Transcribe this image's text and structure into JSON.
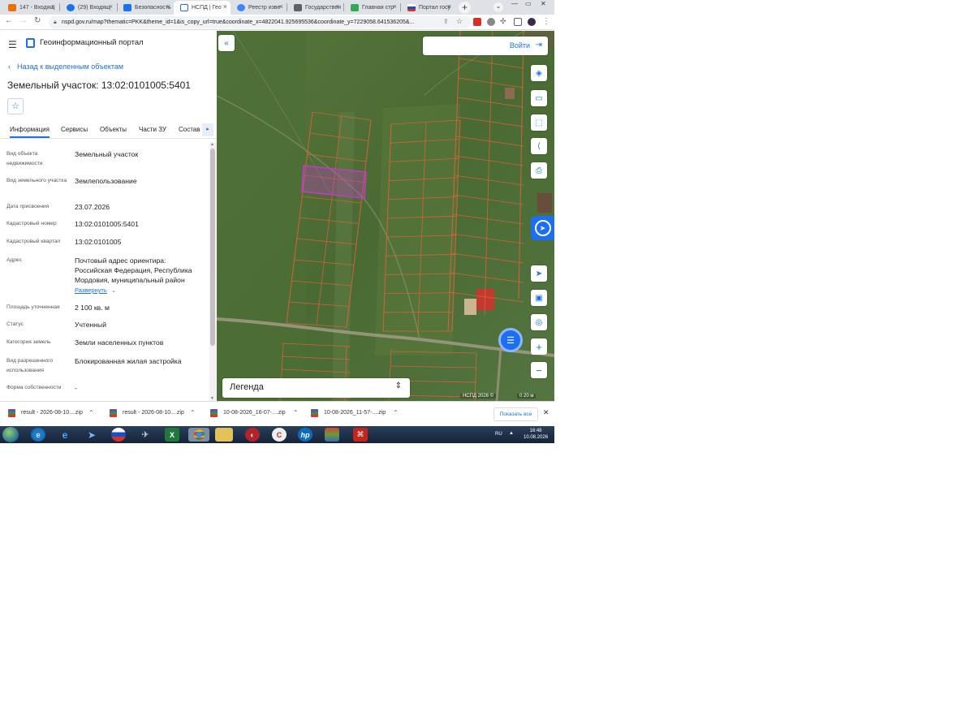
{
  "browser": {
    "tabs": [
      {
        "title": "147 - Входящ",
        "favicon_color": "#e8710a"
      },
      {
        "title": "(29) Входящ",
        "favicon_color": "#1a73e8"
      },
      {
        "title": "Безопасность",
        "favicon_color": "#1a73e8"
      },
      {
        "title": "НСПД | Гео",
        "favicon_color": "#1c6ef2",
        "active": true
      },
      {
        "title": "Реестр изве",
        "favicon_color": "#4285f4"
      },
      {
        "title": "Государствен",
        "favicon_color": "#5f6368"
      },
      {
        "title": "Главная стр",
        "favicon_color": "#34a853"
      },
      {
        "title": "Портал госу",
        "favicon_color": "#d93025"
      }
    ],
    "url": "nspd.gov.ru/map?thematic=PKK&theme_id=1&is_copy_url=true&coordinate_x=4822041.925695536&coordinate_y=7229058.641536205&..."
  },
  "portal": {
    "title": "Геоинформационный портал"
  },
  "panel": {
    "back_label": "Назад к выделенным объектам",
    "parcel_title": "Земельный участок: 13:02:0101005:5401",
    "tabs": [
      "Информация",
      "Сервисы",
      "Объекты",
      "Части ЗУ",
      "Состав"
    ],
    "properties": [
      {
        "label": "Вид объекта недвижимости",
        "value": "Земельный участок"
      },
      {
        "label": "Вид земельного участка",
        "value": "Землепользование"
      },
      {
        "label": "Дата присвоения",
        "value": "23.07.2026"
      },
      {
        "label": "Кадастровый номер",
        "value": "13:02:0101005:5401"
      },
      {
        "label": "Кадастровый квартал",
        "value": "13:02:0101005"
      },
      {
        "label": "Адрес",
        "value": "Почтовый адрес ориентира: Российская Федерация, Республика Мордовия, муниципальный район"
      },
      {
        "label": "Площадь уточненная",
        "value": "2 100 кв. м"
      },
      {
        "label": "Статус",
        "value": "Учтенный"
      },
      {
        "label": "Категория земель",
        "value": "Земли населенных пунктов"
      },
      {
        "label": "Вид разрешенного использования",
        "value": "Блокированная жилая застройка"
      },
      {
        "label": "Форма собственности",
        "value": "-"
      }
    ],
    "expand_label": "Развернуть"
  },
  "map": {
    "login_label": "Войти",
    "legend_label": "Легенда",
    "copyright": "НСПД 2026 ©",
    "scale": "0 20 м",
    "parcel_line_color": "#e8623a",
    "selected_parcel_color": "#c03cc8"
  },
  "downloads": {
    "items": [
      "result - 2026-08-10....zip",
      "result - 2026-08-10....zip",
      "10-08-2026_16-07-....zip",
      "10-08-2026_11-57-....zip"
    ],
    "show_all": "Показать все"
  },
  "taskbar": {
    "lang": "RU",
    "time": "16:48",
    "date": "10.08.2026"
  }
}
